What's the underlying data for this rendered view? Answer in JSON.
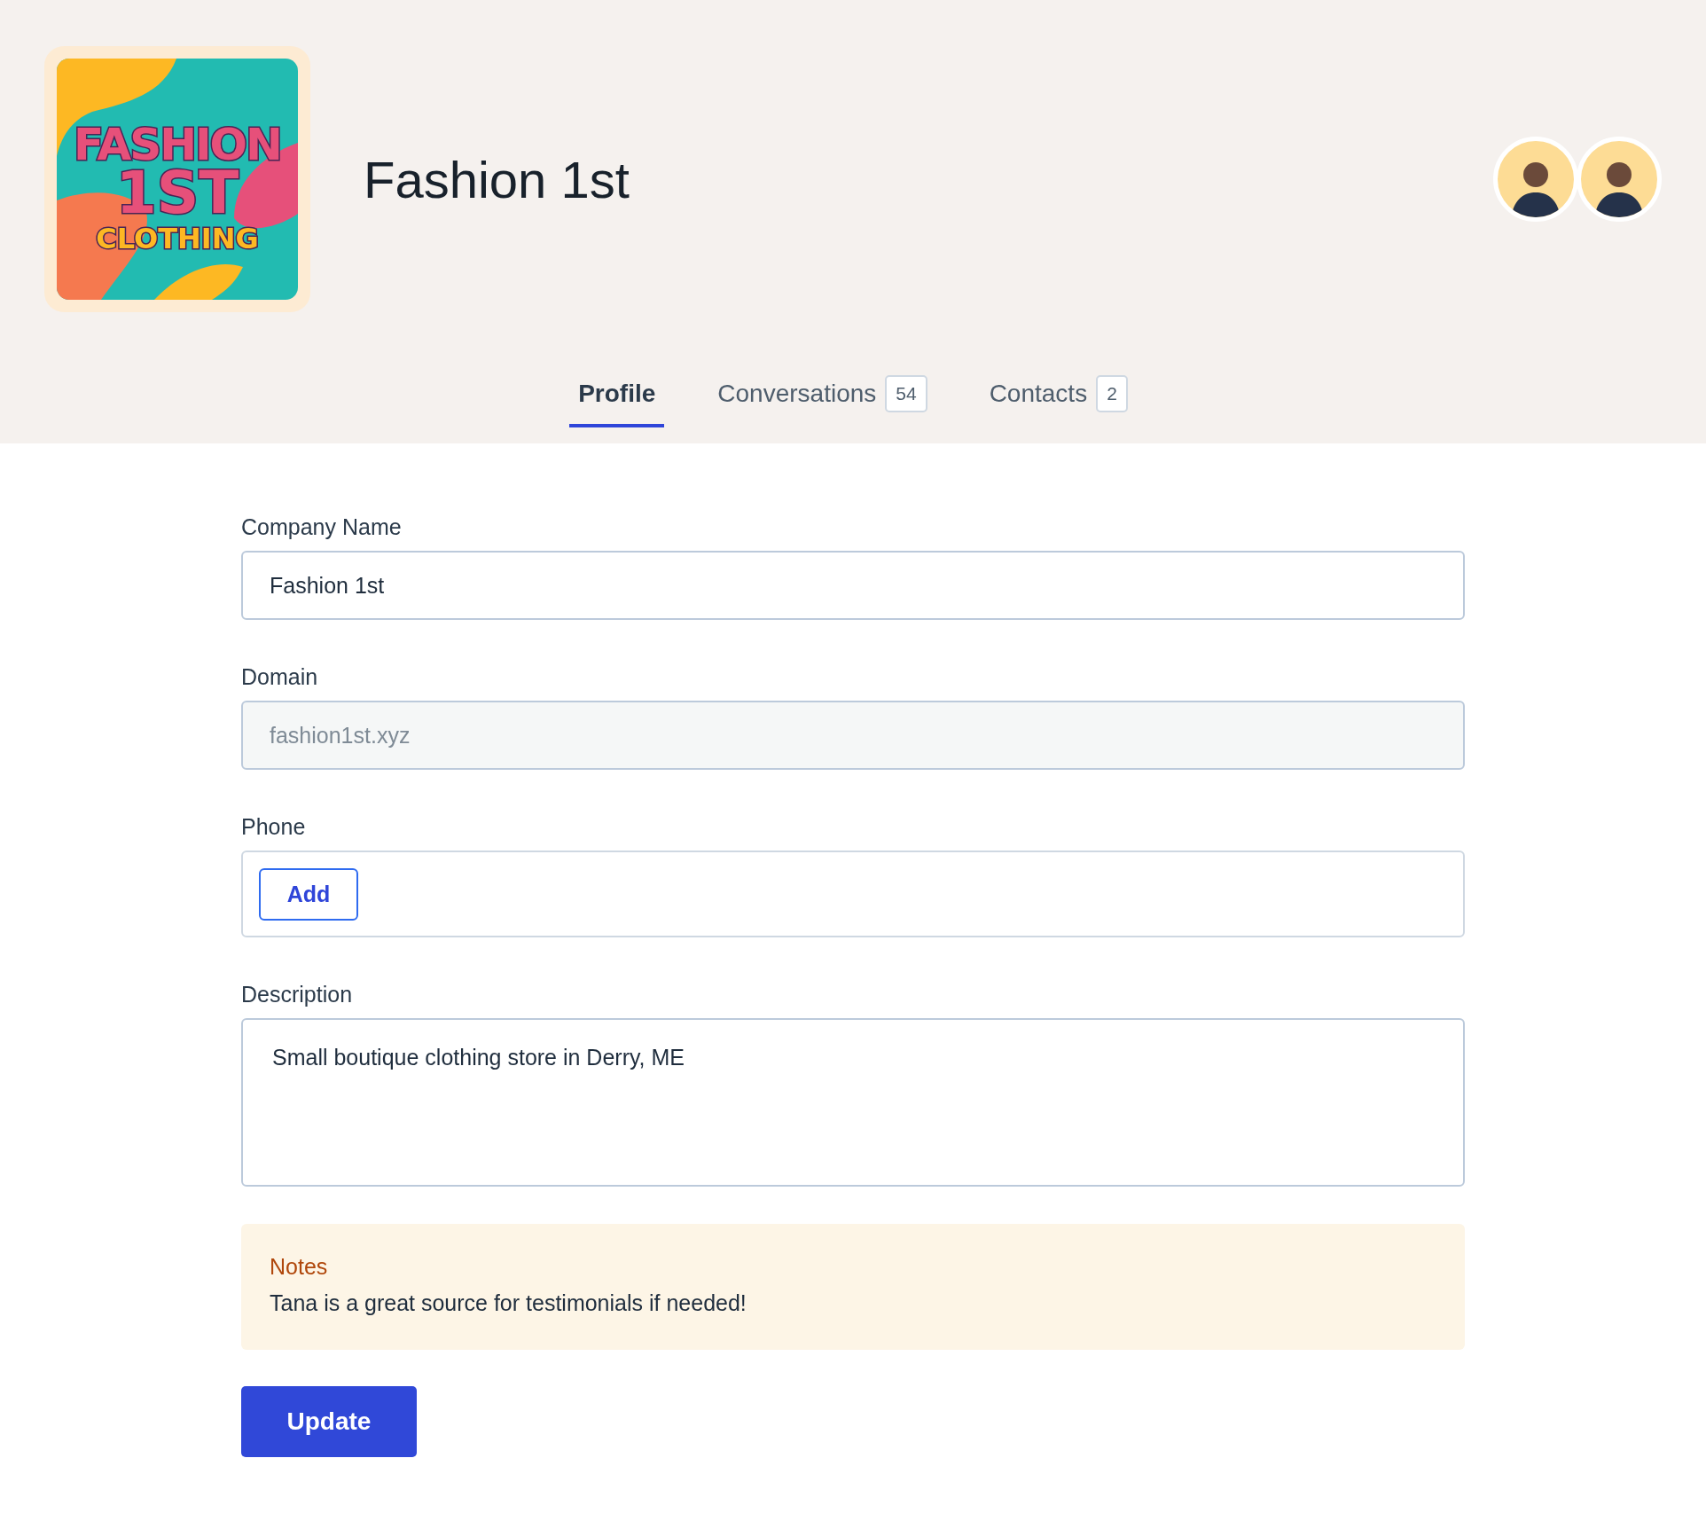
{
  "header": {
    "logo": {
      "lines": [
        "FASHION",
        "1ST",
        "CLOTHING"
      ]
    },
    "title": "Fashion 1st",
    "avatars": [
      {
        "kind": "person"
      },
      {
        "kind": "person"
      }
    ]
  },
  "tabs": [
    {
      "label": "Profile",
      "selected": true
    },
    {
      "label": "Conversations",
      "count": "54",
      "selected": false
    },
    {
      "label": "Contacts",
      "count": "2",
      "selected": false
    }
  ],
  "form": {
    "fields": [
      {
        "kind": "text",
        "label": "Company Name",
        "value": "Fashion 1st",
        "disabled": false
      },
      {
        "kind": "text",
        "label": "Domain",
        "value": "fashion1st.xyz",
        "disabled": true
      },
      {
        "kind": "list",
        "label": "Phone",
        "button": "Add"
      },
      {
        "kind": "textarea",
        "label": "Description",
        "value": "Small boutique clothing store in Derry, ME"
      }
    ],
    "notes": {
      "title": "Notes",
      "text": "Tana is a great source for testimonials if needed!"
    },
    "submit": "Update"
  }
}
